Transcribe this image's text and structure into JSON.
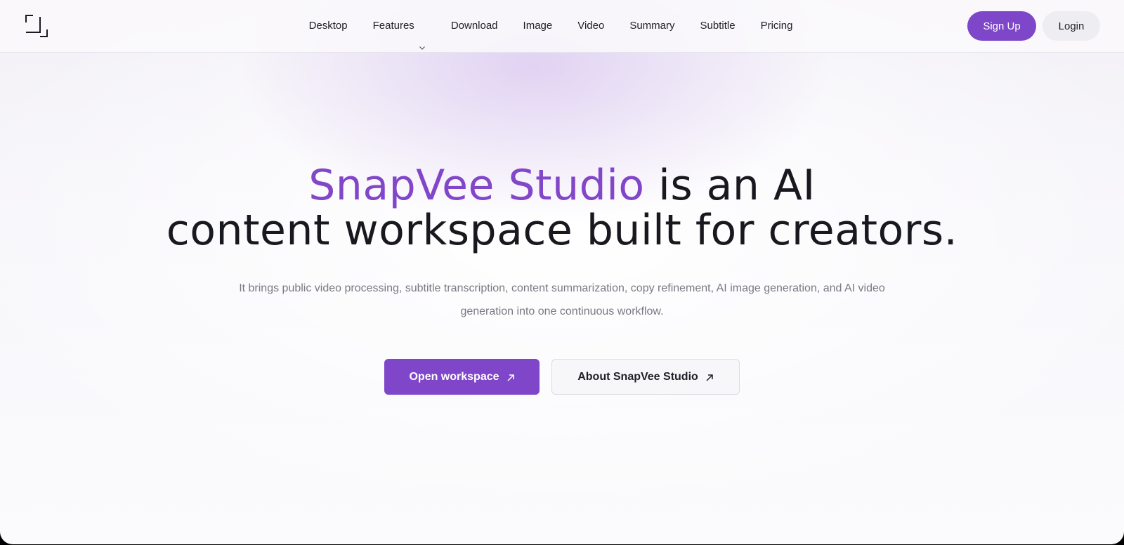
{
  "header": {
    "logo_icon": "corner-brackets-logo-icon",
    "nav": [
      {
        "label": "Desktop"
      },
      {
        "label": "Features",
        "has_dropdown": true
      },
      {
        "label": "Download"
      },
      {
        "label": "Image"
      },
      {
        "label": "Video"
      },
      {
        "label": "Summary"
      },
      {
        "label": "Subtitle"
      },
      {
        "label": "Pricing"
      }
    ],
    "signup_label": "Sign Up",
    "login_label": "Login"
  },
  "hero": {
    "title_accent": "SnapVee Studio",
    "title_line1_rest": " is an AI",
    "title_line2": "content workspace built for creators.",
    "subtitle": "It brings public video processing, subtitle transcription, content summarization, copy refinement, AI image generation, and AI video generation into one continuous workflow.",
    "primary_cta": "Open workspace",
    "secondary_cta": "About SnapVee Studio",
    "cta_icon": "arrow-up-right-icon"
  },
  "colors": {
    "accent": "#8046c9",
    "text": "#18181f",
    "muted": "#7a7a84"
  }
}
